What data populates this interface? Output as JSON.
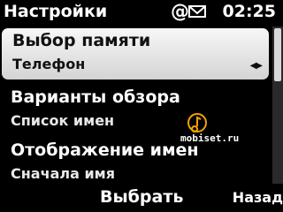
{
  "status_bar": {
    "title": "Настройки",
    "at_symbol": "@",
    "time": "02:25",
    "icons": [
      "mail-icon"
    ]
  },
  "settings_list": [
    {
      "label": "Выбор памяти",
      "value": "Телефон",
      "selected": true
    },
    {
      "label": "Варианты обзора",
      "value": "Список имен",
      "selected": false
    },
    {
      "label": "Отображение имен",
      "value": "Сначала имя",
      "selected": false
    }
  ],
  "watermark": {
    "text": "mobiset.ru"
  },
  "softkeys": {
    "select": "Выбрать",
    "back": "Назад"
  },
  "colors": {
    "background": "#000000",
    "highlight": "#e6e6e6",
    "watermark_accent": "#f4a100"
  }
}
